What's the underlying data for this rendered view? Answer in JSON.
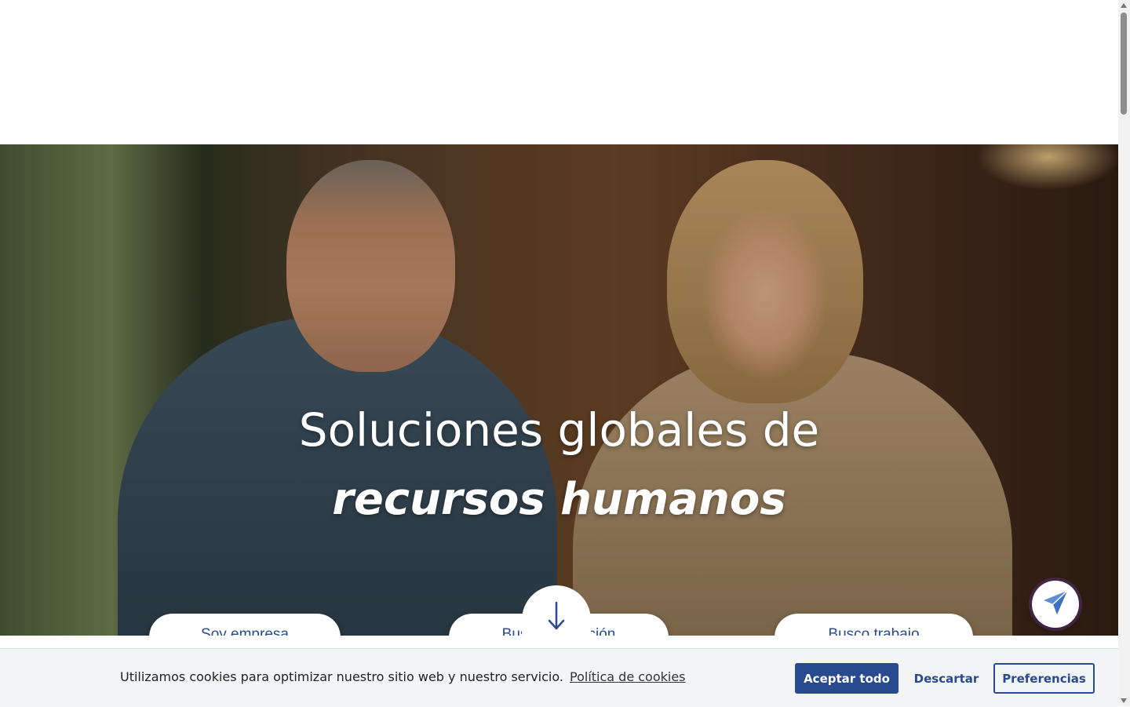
{
  "hero": {
    "title_line1": "Soluciones globales de",
    "title_line2": "recursos humanos",
    "scroll_icon": "arrow-down-icon"
  },
  "actions": {
    "empresa": "Soy empresa",
    "busco_ocupacion": "Busco ocupación",
    "busco_trabajo": "Busco trabajo"
  },
  "fab": {
    "icon": "send-icon"
  },
  "cookie": {
    "message": "Utilizamos cookies para optimizar nuestro sitio web y nuestro servicio.",
    "policy_link": "Política de cookies",
    "accept_all": "Aceptar todo",
    "dismiss": "Descartar",
    "preferences": "Preferencias"
  },
  "colors": {
    "primary": "#2a4a8f",
    "button_text": "#2c4a8c",
    "cookie_bg": "#f3f4f6"
  }
}
